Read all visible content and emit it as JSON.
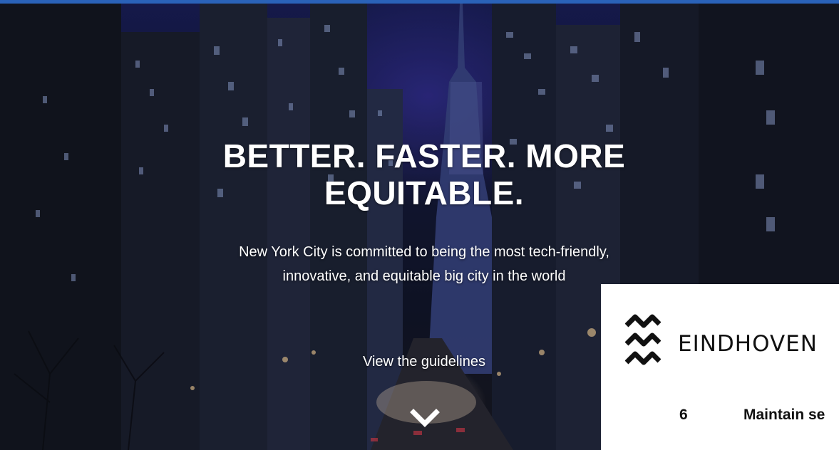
{
  "hero": {
    "headline": "BETTER. FASTER. MORE EQUITABLE.",
    "subtext": "New York City is committed to being the most tech-friendly, innovative, and equitable big city in the world",
    "cta_label": "View the guidelines",
    "scroll_icon": "chevron-down-icon"
  },
  "eindhoven_card": {
    "logo_icon": "eindhoven-wave-logo-icon",
    "wordmark": "EINDHOVEN",
    "item_number": "6",
    "item_text": "Maintain se"
  },
  "colors": {
    "top_bar": "#2a62b8",
    "hero_text": "#ffffff",
    "card_background": "#ffffff",
    "card_text": "#111111"
  }
}
